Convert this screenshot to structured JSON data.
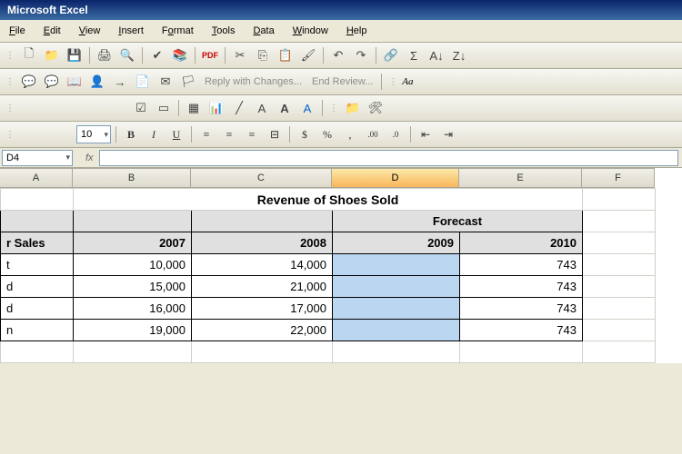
{
  "app": {
    "title": "Microsoft Excel"
  },
  "menu": {
    "file": "File",
    "edit": "Edit",
    "view": "View",
    "insert": "Insert",
    "format": "Format",
    "tools": "Tools",
    "data": "Data",
    "window": "Window",
    "help": "Help"
  },
  "reviewing": {
    "reply": "Reply with Changes...",
    "end": "End Review..."
  },
  "format_bar": {
    "font_size": "10",
    "bold": "B",
    "italic": "I",
    "underline": "U",
    "currency": "$",
    "percent": "%",
    "comma": ","
  },
  "name_box": "D4",
  "fx_label": "fx",
  "columns": [
    "A",
    "B",
    "C",
    "D",
    "E",
    "F"
  ],
  "sheet": {
    "title": "Revenue of Shoes Sold",
    "forecast_label": "Forecast",
    "row_labels": [
      "r Sales",
      "t",
      "d",
      "d",
      "n"
    ],
    "headers": [
      "2007",
      "2008",
      "2009",
      "2010"
    ],
    "data": [
      {
        "a": "t",
        "b": "10,000",
        "c": "14,000",
        "d": "",
        "e": "743"
      },
      {
        "a": "d",
        "b": "15,000",
        "c": "21,000",
        "d": "",
        "e": "743"
      },
      {
        "a": "d",
        "b": "16,000",
        "c": "17,000",
        "d": "",
        "e": "743"
      },
      {
        "a": "n",
        "b": "19,000",
        "c": "22,000",
        "d": "",
        "e": "743"
      }
    ]
  },
  "chart_data": {
    "type": "table",
    "title": "Revenue of Shoes Sold",
    "columns": [
      "2007",
      "2008",
      "2009",
      "2010"
    ],
    "forecast_columns": [
      "2009",
      "2010"
    ],
    "rows": [
      [
        10000,
        14000,
        null,
        743
      ],
      [
        15000,
        21000,
        null,
        743
      ],
      [
        16000,
        17000,
        null,
        743
      ],
      [
        19000,
        22000,
        null,
        743
      ]
    ]
  }
}
